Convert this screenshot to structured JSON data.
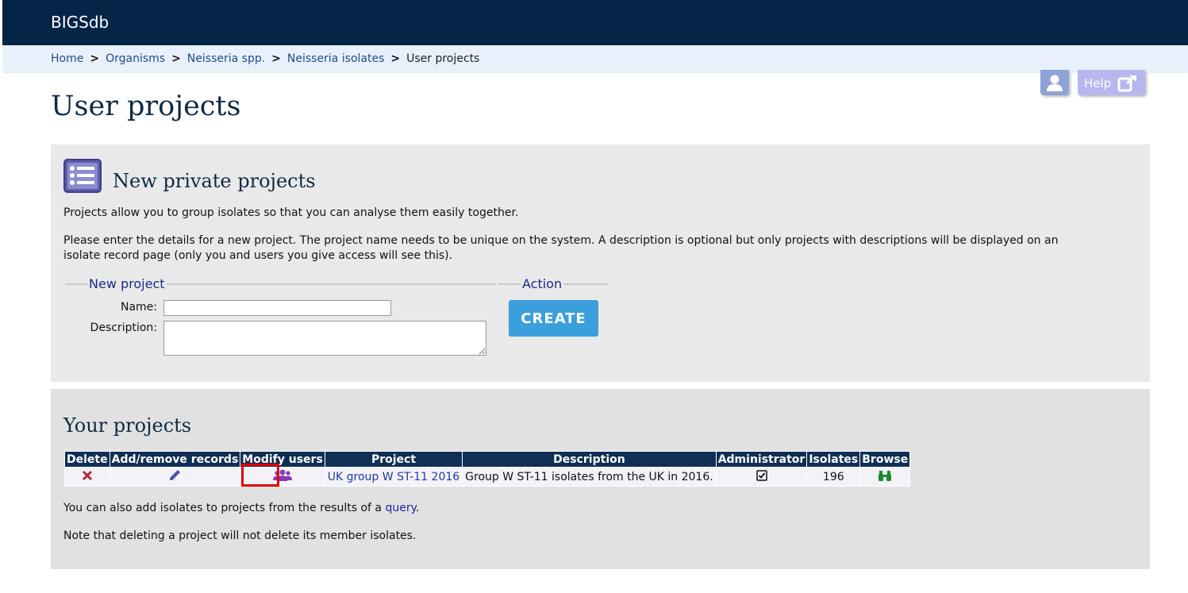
{
  "header": {
    "brand": "BIGSdb"
  },
  "breadcrumb": {
    "items": [
      "Home",
      "Organisms",
      "Neisseria spp.",
      "Neisseria isolates"
    ],
    "current": "User projects",
    "separator": ">"
  },
  "toolbar": {
    "help_label": "Help"
  },
  "page": {
    "title": "User projects"
  },
  "new_projects": {
    "heading": "New private projects",
    "intro": "Projects allow you to group isolates so that you can analyse them easily together.",
    "instructions": "Please enter the details for a new project. The project name needs to be unique on the system. A description is optional but only projects with descriptions will be displayed on an isolate record page (only you and users you give access will see this).",
    "form_legend": "New project",
    "name_label": "Name:",
    "name_value": "",
    "description_label": "Description:",
    "description_value": "",
    "action_legend": "Action",
    "create_label": "CREATE"
  },
  "your_projects": {
    "heading": "Your projects",
    "columns": [
      "Delete",
      "Add/remove records",
      "Modify users",
      "Project",
      "Description",
      "Administrator",
      "Isolates",
      "Browse"
    ],
    "rows": [
      {
        "project": "UK group W ST-11 2016",
        "description": "Group W ST-11 isolates from the UK in 2016.",
        "administrator": true,
        "isolates": "196"
      }
    ],
    "note_prefix": "You can also add isolates to projects from the results of a ",
    "note_link": "query",
    "note_suffix": ".",
    "note2": "Note that deleting a project will not delete its member isolates."
  },
  "colors": {
    "header_bg": "#052547",
    "breadcrumb_bg": "#e8f1fb",
    "create_button": "#3b9fdc",
    "highlight": "#e00000"
  }
}
